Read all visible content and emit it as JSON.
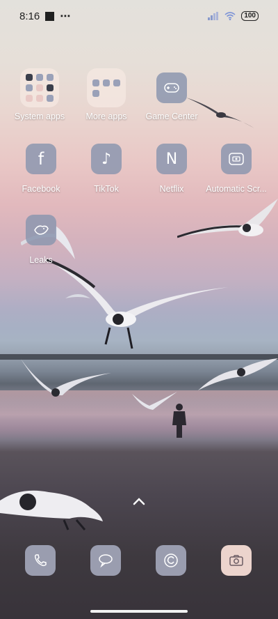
{
  "status_bar": {
    "time": "8:16",
    "more_indicator": "⋯",
    "battery": "100"
  },
  "apps": [
    {
      "id": "system-apps",
      "label": "System apps",
      "type": "folder"
    },
    {
      "id": "more-apps",
      "label": "More apps",
      "type": "folder"
    },
    {
      "id": "game-center",
      "label": "Game Center",
      "icon": "gamepad-icon"
    },
    {
      "id": "facebook",
      "label": "Facebook",
      "icon": "facebook-icon",
      "glyph": "f"
    },
    {
      "id": "tiktok",
      "label": "TikTok",
      "icon": "tiktok-icon",
      "glyph": "♪"
    },
    {
      "id": "netflix",
      "label": "Netflix",
      "icon": "netflix-icon",
      "glyph": "N"
    },
    {
      "id": "automatic-scr",
      "label": "Automatic Scr...",
      "icon": "screen-recorder-icon"
    },
    {
      "id": "leaks",
      "label": "Leaks",
      "icon": "bird-icon"
    }
  ],
  "dock": [
    {
      "id": "phone",
      "icon": "phone-icon"
    },
    {
      "id": "messages",
      "icon": "message-icon"
    },
    {
      "id": "browser",
      "icon": "browser-icon"
    },
    {
      "id": "camera",
      "icon": "camera-icon"
    }
  ],
  "colors": {
    "tile": "#8c96af",
    "camera_tile": "#ecd4cd",
    "folder_bg": "#f5e8e2"
  }
}
